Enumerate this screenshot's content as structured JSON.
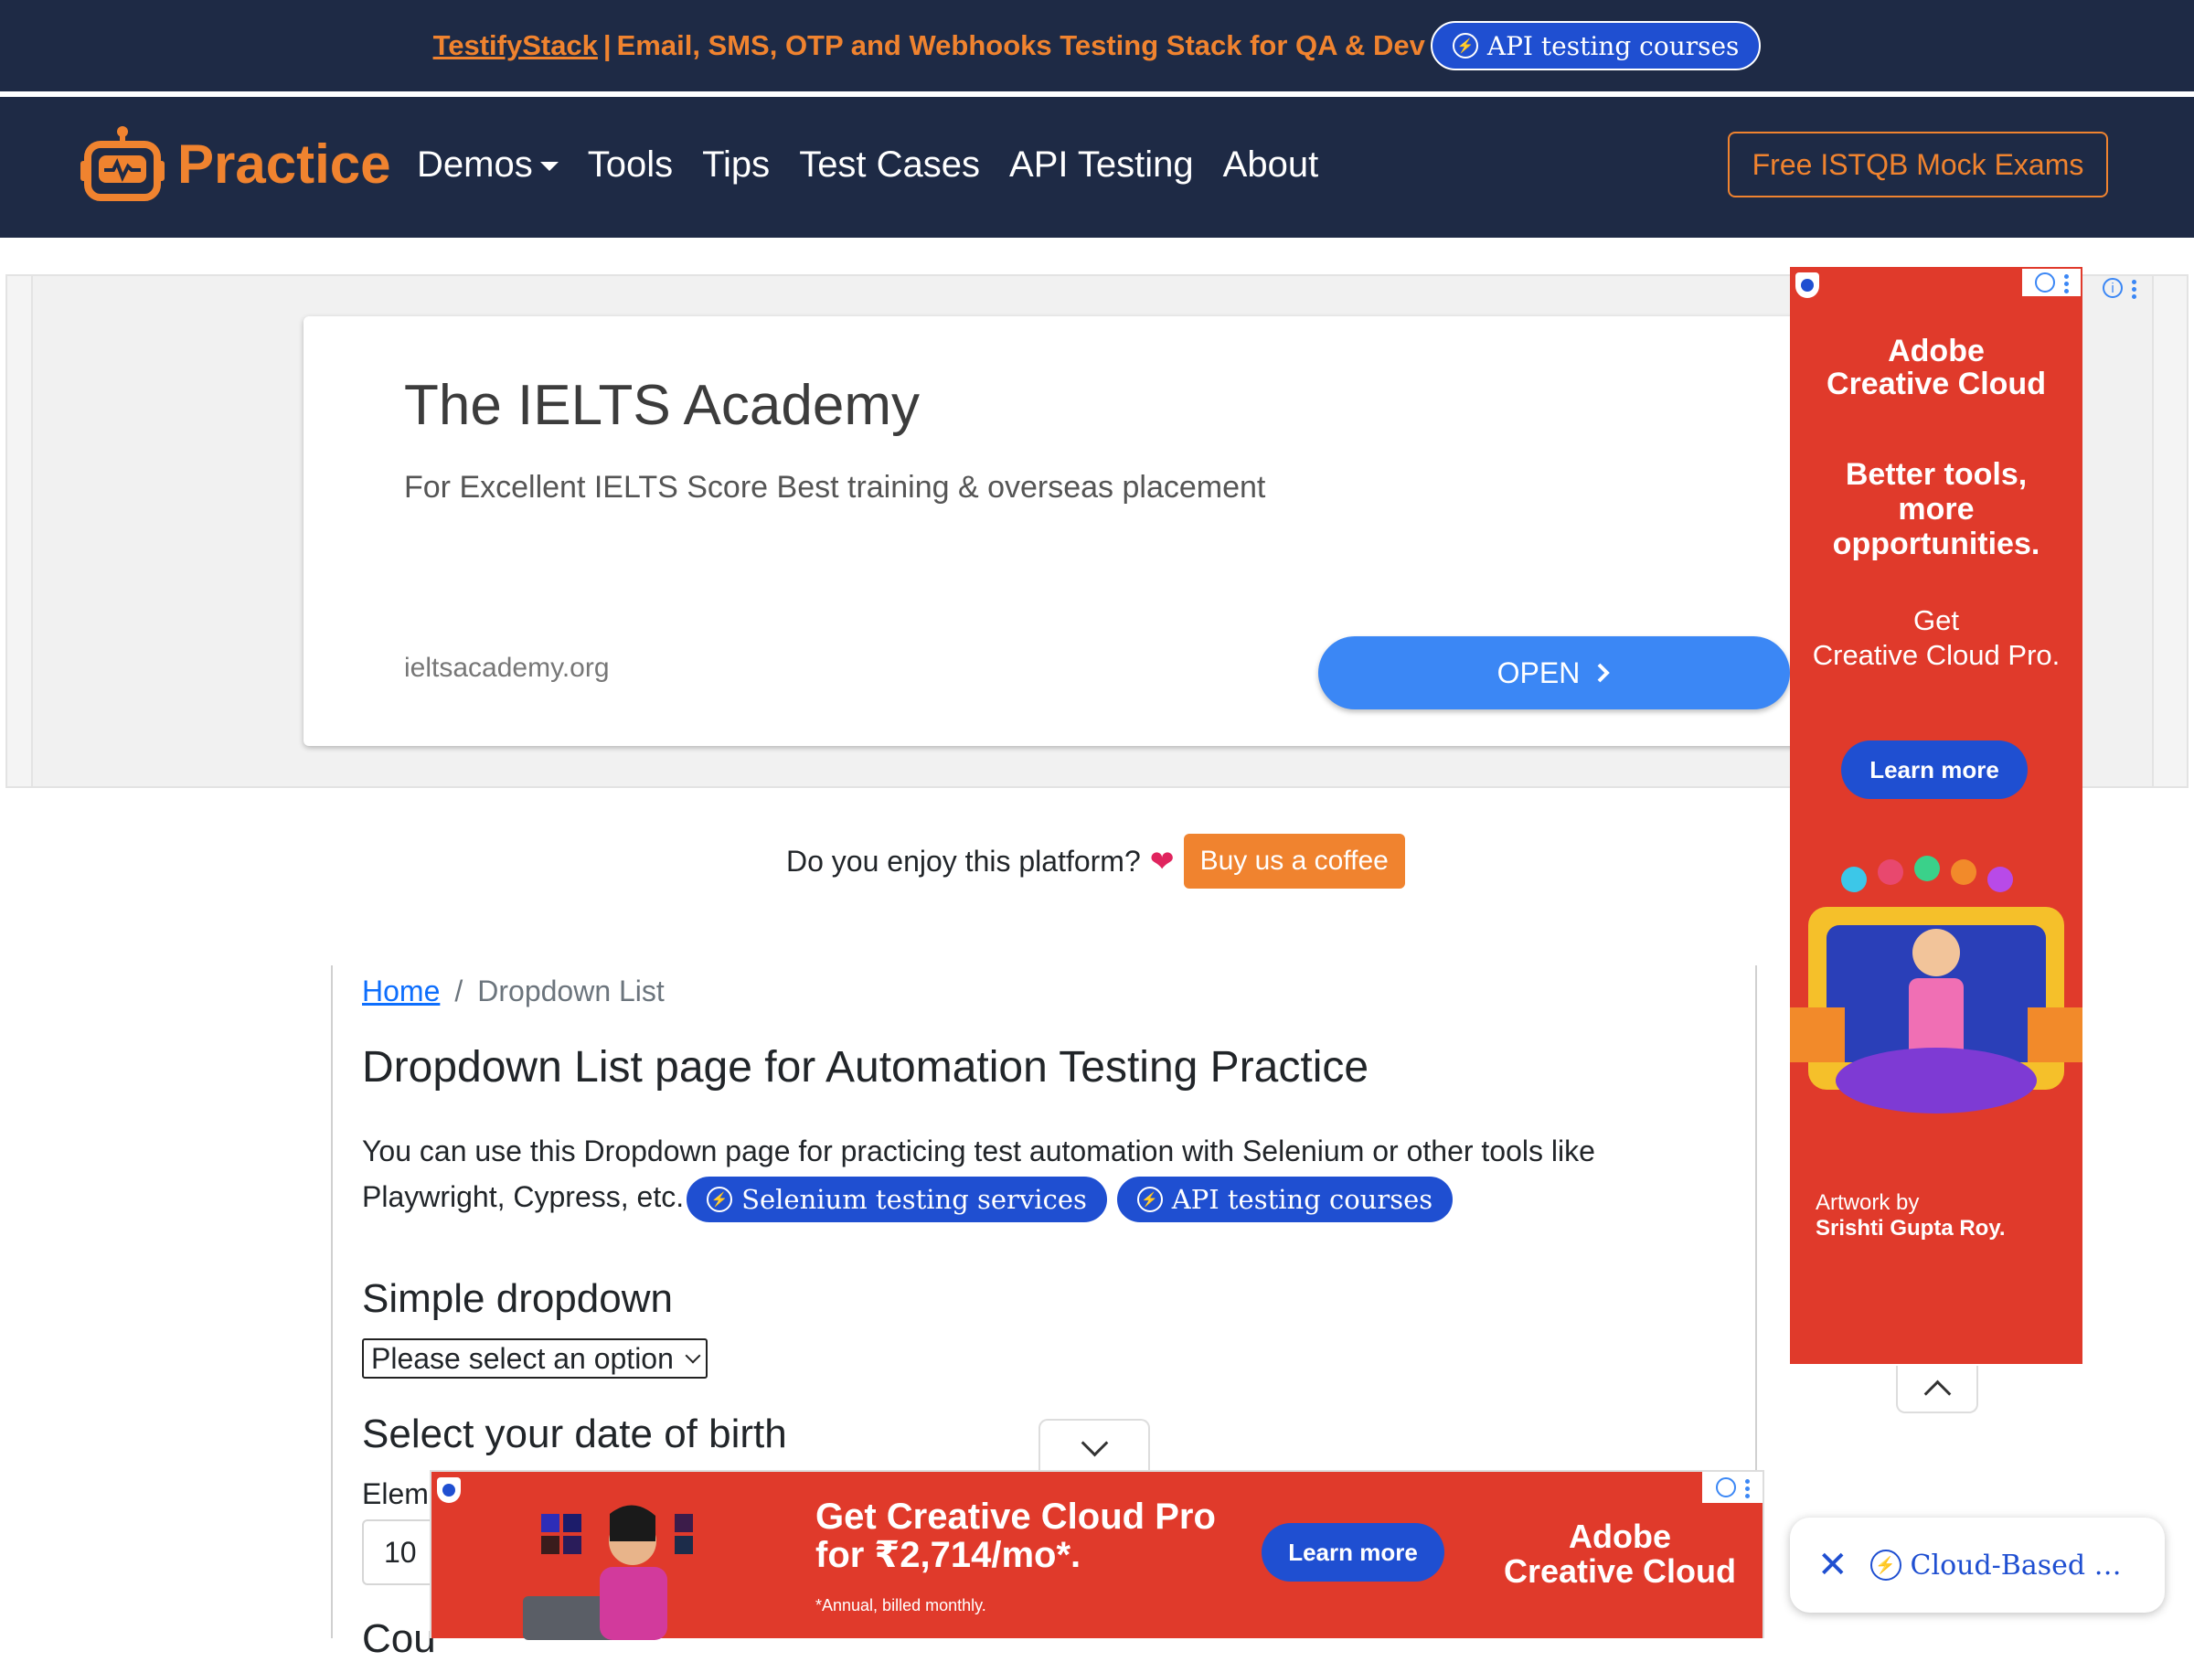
{
  "promo": {
    "brand_link": "TestifyStack",
    "separator": "|",
    "tagline": "Email, SMS, OTP and Webhooks Testing Stack for QA & Dev",
    "pill_label": "API testing courses"
  },
  "nav": {
    "brand": "Practice",
    "links": [
      "Demos",
      "Tools",
      "Tips",
      "Test Cases",
      "API Testing",
      "About"
    ],
    "cta": "Free ISTQB Mock Exams"
  },
  "ad_banner": {
    "title": "The IELTS Academy",
    "subtitle": "For Excellent IELTS Score Best training & overseas placement",
    "domain": "ieltsacademy.org",
    "button": "OPEN"
  },
  "coffee": {
    "text": "Do you enjoy this platform?",
    "button": "Buy us a coffee"
  },
  "breadcrumb": {
    "home": "Home",
    "separator": "/",
    "current": "Dropdown List"
  },
  "page": {
    "title": "Dropdown List page for Automation Testing Practice",
    "intro": "You can use this Dropdown page for practicing test automation with Selenium or other tools like Playwright, Cypress, etc.",
    "pill_selenium": "Selenium testing services",
    "pill_api": "API testing courses",
    "simple_heading": "Simple dropdown",
    "simple_select_value": "Please select an option",
    "dob_heading": "Select your date of birth",
    "element_label_partial": "Eleme",
    "day_value": "10",
    "next_heading_partial": "Cou"
  },
  "side_ad": {
    "brand_line1": "Adobe",
    "brand_line2": "Creative Cloud",
    "tag_line1": "Better tools,",
    "tag_line2": "more",
    "tag_line3": "opportunities.",
    "get_line1": "Get",
    "get_line2": "Creative Cloud Pro.",
    "button": "Learn more",
    "credit_line1": "Artwork by",
    "credit_line2": "Srishti Gupta Roy."
  },
  "bottom_ad": {
    "headline_line1": "Get Creative Cloud Pro",
    "headline_line2": "for ₹2,714/mo*.",
    "fine_print": "*Annual, billed monthly.",
    "button": "Learn more",
    "brand_line1": "Adobe",
    "brand_line2": "Creative Cloud"
  },
  "floating_pill": {
    "text": "Cloud-Based …"
  },
  "colors": {
    "navy": "#1e2a45",
    "orange": "#f0832f",
    "link_blue": "#0d6efd",
    "pill_blue": "#1f4fd1",
    "adobe_red": "#e03a2b"
  },
  "icons": [
    "bolt-circle-icon",
    "robot-logo-icon",
    "caret-down-icon",
    "chevron-right-icon",
    "info-icon",
    "more-vert-icon",
    "heart-icon",
    "shield-icon",
    "chevron-up-icon",
    "chevron-down-icon",
    "close-icon"
  ]
}
